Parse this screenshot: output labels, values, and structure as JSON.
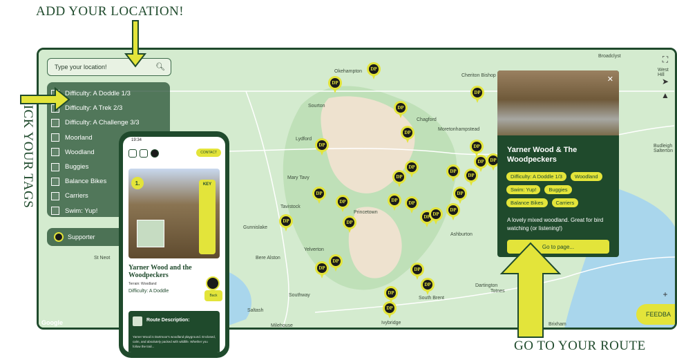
{
  "annotations": {
    "top": "ADD YOUR LOCATION!",
    "left": "PICK YOUR TAGS",
    "bottom": "GO TO YOUR ROUTE"
  },
  "search": {
    "placeholder": "Type your location!"
  },
  "tags": [
    "Difficulty: A Doddle 1/3",
    "Difficulty: A Trek 2/3",
    "Difficulty: A Challenge 3/3",
    "Moorland",
    "Woodland",
    "Buggies",
    "Balance Bikes",
    "Carriers",
    "Swim: Yup!"
  ],
  "supporter_label": "Supporter",
  "towns": [
    "Okehampton",
    "Cheriton Bishop",
    "Broadclyst",
    "West Hill",
    "Sourton",
    "Chagford",
    "Moretonhampstead",
    "Lydford",
    "Budleigh Salterton",
    "Mary Tavy",
    "Princetown",
    "Tavistock",
    "Gunnislake",
    "Ashburton",
    "Yelverton",
    "Bere Alston",
    "St Neot",
    "Southway",
    "South Brent",
    "Totnes",
    "Ivybridge",
    "Saltash",
    "Milehouse",
    "Dartington",
    "Brixham"
  ],
  "pin_label": "DP",
  "popup": {
    "title": "Yarner Wood & The Woodpeckers",
    "chips": [
      "Difficulty: A Doddle 1/3",
      "Woodland",
      "Swim: Yup!",
      "Buggies",
      "Balance Bikes",
      "Carriers"
    ],
    "description": "A lovely mixed woodland. Great for bird watching (or listening!)",
    "button": "Go to page..."
  },
  "feedback": "FEEDBA",
  "google": "Google",
  "phone": {
    "time": "19:34",
    "contact": "CONTACT",
    "number": "1.",
    "key": "KEY",
    "title": "Yarner Wood and the Woodpeckers",
    "terrain": "Terrain: Woodland",
    "difficulty": "Difficulty: A Doddle",
    "back": "Back",
    "route_title": "Route Description:",
    "route_text": "Yarner Wood is Dartmoor's woodland playground. Enclosed, calm, and absolutely packed with wildlife. Whether you follow the trail..."
  }
}
